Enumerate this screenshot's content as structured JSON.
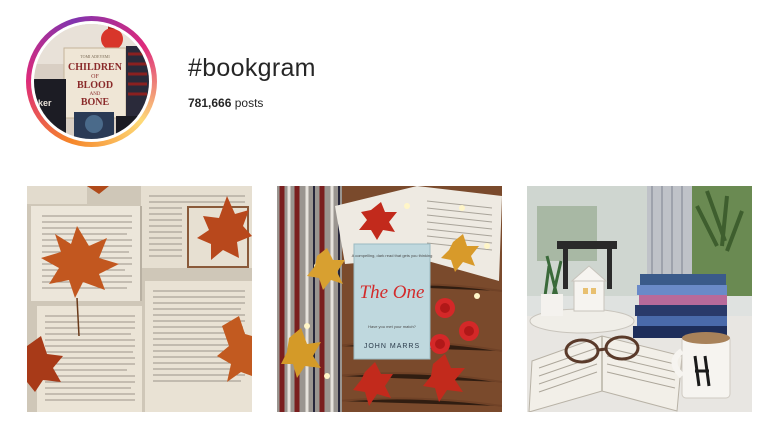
{
  "hashtag": {
    "title": "#bookgram",
    "post_count": "781,666",
    "post_count_suffix": " posts"
  },
  "avatar_book": {
    "author": "TOMI ADEYEMI",
    "title_line1": "CHILDREN",
    "title_line2": "OF",
    "title_line3": "BLOOD",
    "title_line4": "AND",
    "title_line5": "BONE",
    "side_text": "ker"
  },
  "posts": [
    {
      "name": "autumn-leaves-open-books"
    },
    {
      "name": "the-one-book",
      "book_quote": "A compelling, dark read that gets you thinking",
      "book_title": "The One",
      "book_tagline": "Have you met your match?",
      "book_author": "JOHN MARRS"
    },
    {
      "name": "books-glasses-mug"
    }
  ],
  "colors": {
    "ring_start": "#f58529",
    "ring_mid": "#dd2a7b",
    "ring_end": "#8134af"
  }
}
